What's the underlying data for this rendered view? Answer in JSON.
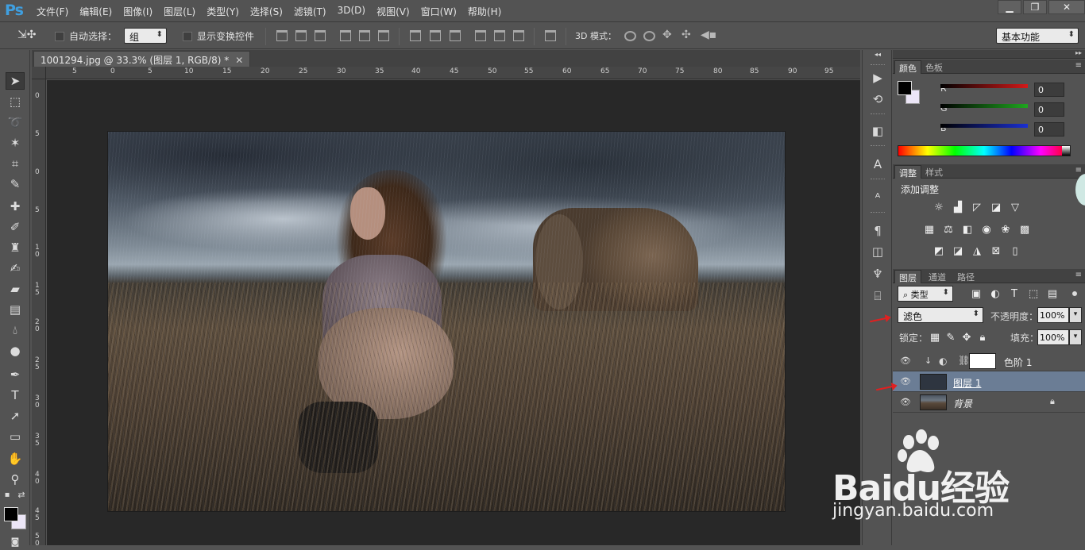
{
  "app": {
    "logo": "Ps"
  },
  "menu": [
    "文件(F)",
    "编辑(E)",
    "图像(I)",
    "图层(L)",
    "类型(Y)",
    "选择(S)",
    "滤镜(T)",
    "3D(D)",
    "视图(V)",
    "窗口(W)",
    "帮助(H)"
  ],
  "window_controls": {
    "minimize": "▁",
    "restore": "❐",
    "close": "✕"
  },
  "options": {
    "auto_select_label": "自动选择：",
    "auto_select_value": "组",
    "show_transform_label": "显示变换控件",
    "mode_3d_label": "3D 模式：",
    "workspace": "基本功能"
  },
  "document": {
    "tab_title": "1001294.jpg @ 33.3% (图层 1, RGB/8) *",
    "tab_close": "✕",
    "ruler_h_ticks": [
      "5",
      "0",
      "5",
      "10",
      "15",
      "20",
      "25",
      "30",
      "35",
      "40",
      "45",
      "50",
      "55",
      "60",
      "65",
      "70",
      "75",
      "80",
      "85",
      "90",
      "95"
    ],
    "ruler_v_ticks": [
      "0",
      "5",
      "0",
      "5",
      "1 0",
      "1 5",
      "2 0",
      "2 5",
      "3 0",
      "3 5",
      "4 0",
      "4 5",
      "5 0"
    ]
  },
  "panels": {
    "color": {
      "tabs": [
        "颜色",
        "色板"
      ],
      "r_label": "R",
      "g_label": "G",
      "b_label": "B",
      "r": "0",
      "g": "0",
      "b": "0",
      "colors": {
        "r": "#d21a1a",
        "g": "#1fa51f",
        "b": "#1a2fd2"
      }
    },
    "adjust": {
      "tabs": [
        "调整",
        "样式"
      ],
      "title": "添加调整"
    },
    "layers": {
      "tabs": [
        "图层",
        "通道",
        "路径"
      ],
      "filter_label": "类型",
      "blend_mode": "滤色",
      "opacity_label": "不透明度：",
      "opacity": "100%",
      "lock_label": "锁定：",
      "fill_label": "填充：",
      "fill": "100%",
      "items": [
        {
          "name": "色阶 1",
          "type": "adjustment"
        },
        {
          "name": "图层 1",
          "type": "pixel",
          "selected": true
        },
        {
          "name": "背景",
          "type": "background",
          "locked": true
        }
      ]
    }
  },
  "watermark": {
    "brand": "Baidu经验",
    "url": "jingyan.baidu.com"
  }
}
